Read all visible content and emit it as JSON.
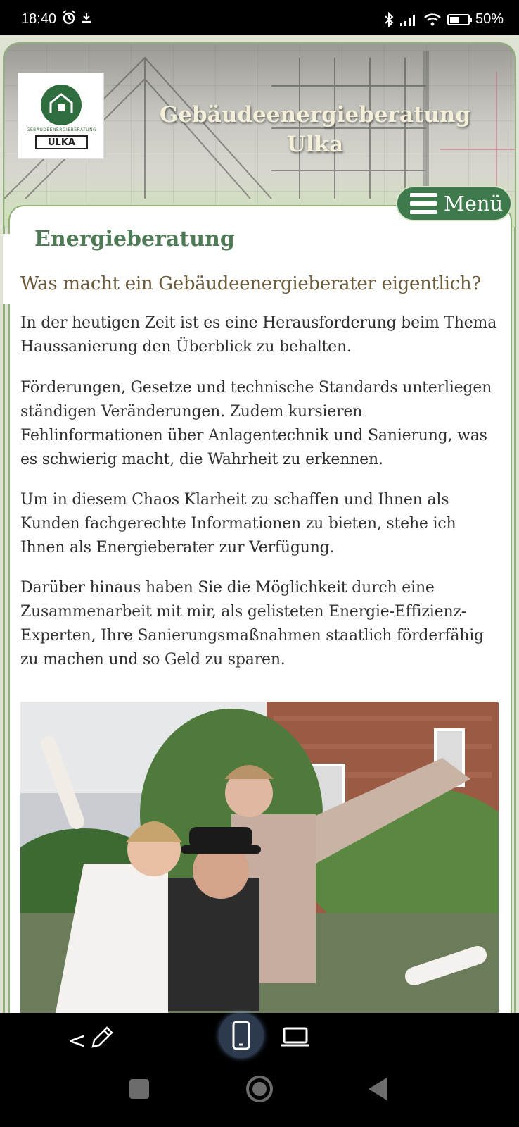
{
  "status_bar": {
    "time": "18:40",
    "battery": "50%"
  },
  "header": {
    "logo_tiny_text": "GEBÄUDEENERGIEBERATUNG",
    "logo_plate": "ULKA",
    "title_line1": "Gebäudeenergieberatung",
    "title_line2": "Ulka"
  },
  "menu": {
    "label": "Menü"
  },
  "content": {
    "page_heading": "Energieberatung",
    "question": "Was macht ein Gebäudeenergieberater eigentlich?",
    "paragraphs": [
      "In der heutigen Zeit ist es eine Herausforderung beim Thema Haussanierung den Überblick zu behalten.",
      "Förderungen, Gesetze und technische Standards unterliegen ständigen Veränderungen. Zudem kursieren Fehlinformationen über Anlagentechnik und Sanierung, was es schwierig macht, die Wahrheit zu erkennen.",
      "Um in diesem Chaos Klarheit zu schaffen und Ihnen als Kunden fachgerechte Informationen zu bieten, stehe ich Ihnen als Energieberater zur Verfügung.",
      "Darüber hinaus haben Sie die Möglichkeit durch eine Zusammenarbeit mit mir, als gelisteten Energie-Effizienz-Experten, Ihre Sanierungsmaßnahmen staatlich förderfähig zu machen und so Geld zu sparen."
    ]
  },
  "colors": {
    "brand_green": "#3e7a4c",
    "heading_green": "#4e7a55",
    "question_brown": "#6b5a3a"
  },
  "icons": [
    "alarm-icon",
    "download-icon",
    "bluetooth-icon",
    "signal-icon",
    "wifi-icon",
    "battery-icon",
    "hamburger-icon",
    "back-chevron-icon",
    "pencil-icon",
    "mobile-icon",
    "laptop-icon"
  ]
}
